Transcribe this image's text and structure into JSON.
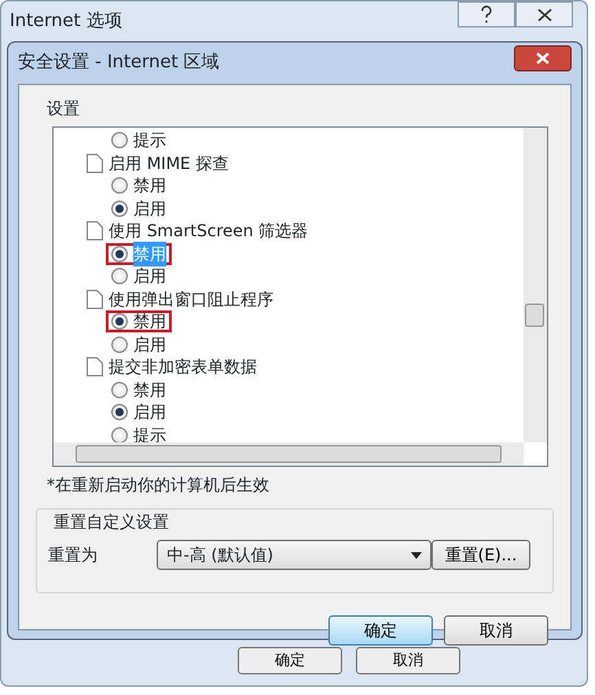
{
  "parent_window": {
    "title": "Internet 选项",
    "buttons": [
      "确定",
      "取消"
    ]
  },
  "dialog": {
    "title": "安全设置 - Internet 区域",
    "settings": {
      "label": "设置",
      "items": [
        {
          "kind": "option",
          "label": "提示",
          "checked": false,
          "highlighted": false
        },
        {
          "kind": "setting",
          "label": "启用 MIME 探查"
        },
        {
          "kind": "option",
          "label": "禁用",
          "checked": false,
          "highlighted": false
        },
        {
          "kind": "option",
          "label": "启用",
          "checked": true,
          "highlighted": false
        },
        {
          "kind": "setting",
          "label": "使用 SmartScreen 筛选器"
        },
        {
          "kind": "option",
          "label": "禁用",
          "checked": true,
          "highlighted": true
        },
        {
          "kind": "option",
          "label": "启用",
          "checked": false,
          "highlighted": false
        },
        {
          "kind": "setting",
          "label": "使用弹出窗口阻止程序"
        },
        {
          "kind": "option",
          "label": "禁用",
          "checked": true,
          "highlighted": true
        },
        {
          "kind": "option",
          "label": "启用",
          "checked": false,
          "highlighted": false
        },
        {
          "kind": "setting",
          "label": "提交非加密表单数据"
        },
        {
          "kind": "option",
          "label": "禁用",
          "checked": false,
          "highlighted": false
        },
        {
          "kind": "option",
          "label": "启用",
          "checked": true,
          "highlighted": false
        },
        {
          "kind": "option",
          "label": "提示",
          "checked": false,
          "highlighted": false
        }
      ],
      "note": "*在重新启动你的计算机后生效"
    },
    "reset": {
      "label": "重置自定义设置",
      "field_label": "重置为",
      "value": "中-高 (默认值)",
      "button": "重置(E)..."
    },
    "buttons": [
      {
        "label": "确定",
        "default": true
      },
      {
        "label": "取消",
        "default": false
      }
    ]
  }
}
